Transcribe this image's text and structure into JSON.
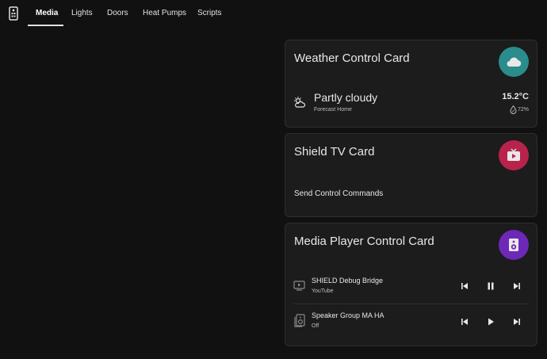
{
  "nav": {
    "tabs": [
      {
        "label": "Media",
        "active": true
      },
      {
        "label": "Lights"
      },
      {
        "label": "Doors"
      },
      {
        "label": "Heat Pumps"
      },
      {
        "label": "Scripts"
      }
    ]
  },
  "weather_card": {
    "title": "Weather Control Card",
    "condition": "Partly cloudy",
    "source": "Forecast Home",
    "temperature": "15.2°C",
    "humidity": "72%",
    "badge_color": "#2a8c8c"
  },
  "shield_card": {
    "title": "Shield TV Card",
    "subtitle": "Send Control Commands",
    "badge_color": "#b8234c"
  },
  "media_card": {
    "title": "Media Player Control Card",
    "badge_color": "#6d28b8",
    "players": [
      {
        "name": "SHIELD Debug Bridge",
        "state": "YouTube",
        "icon": "tv-icon",
        "play_state": "playing"
      },
      {
        "name": "Speaker Group MA HA",
        "state": "Off",
        "icon": "speaker-icon",
        "play_state": "stopped"
      }
    ]
  }
}
